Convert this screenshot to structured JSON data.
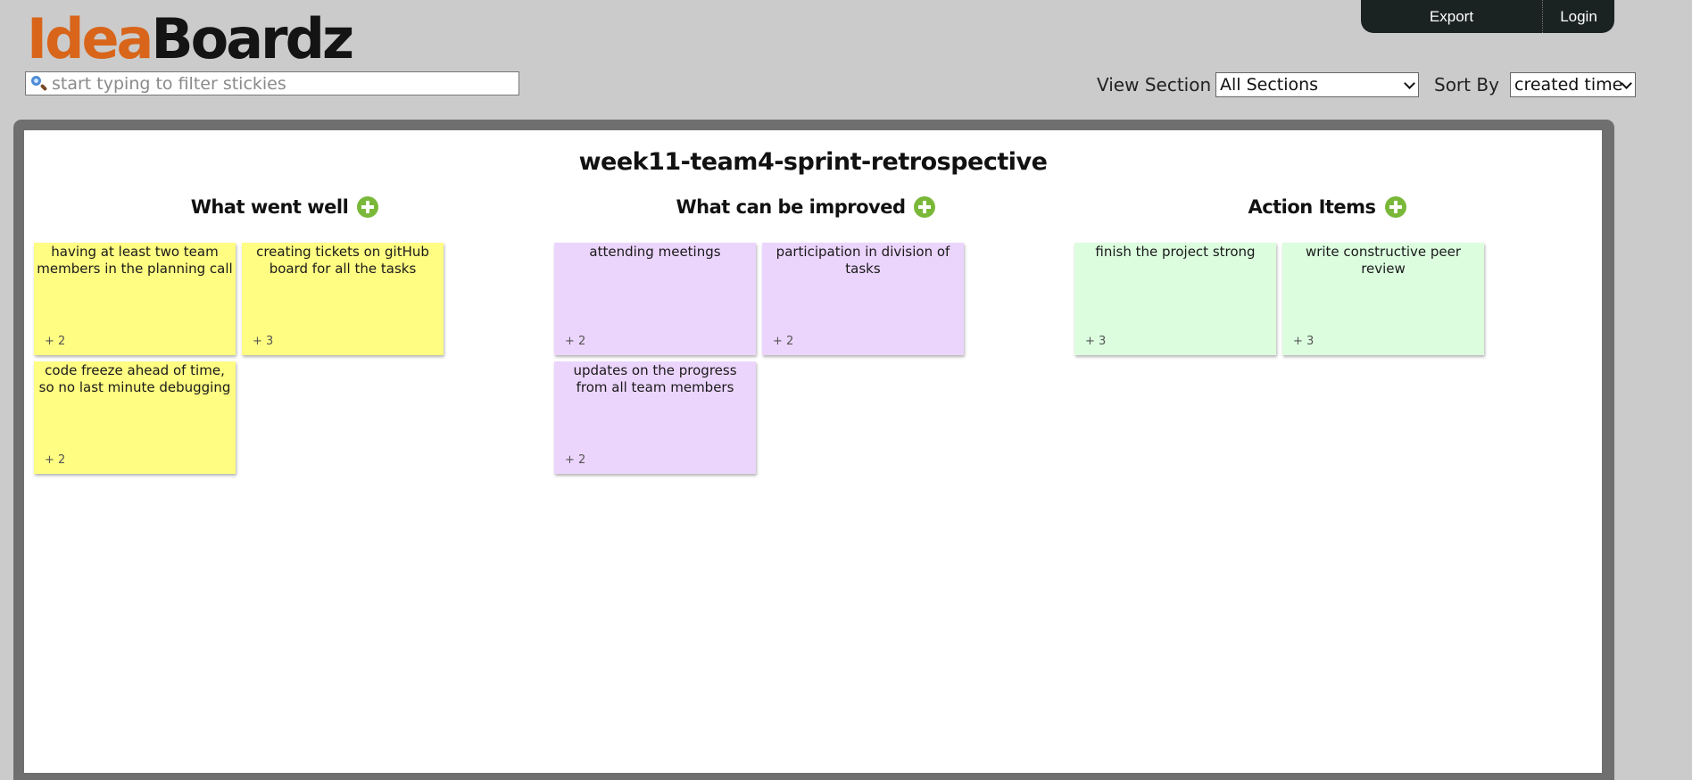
{
  "topbar": {
    "export_label": "Export",
    "login_label": "Login"
  },
  "logo": {
    "part1": "Idea",
    "part2": "Boardz"
  },
  "filter": {
    "placeholder": "start typing to filter stickies",
    "value": ""
  },
  "controls": {
    "view_section_label": "View Section",
    "view_section_value": "All Sections",
    "sort_by_label": "Sort By",
    "sort_by_value": "created time"
  },
  "board": {
    "title": "week11-team4-sprint-retrospective",
    "sections": [
      {
        "title": "What went well",
        "color": "#fffd82",
        "stickies": [
          {
            "text": "having at least two team members in the planning call",
            "votes": "+ 2"
          },
          {
            "text": "creating tickets on gitHub board for all the tasks",
            "votes": "+ 3"
          },
          {
            "text": "code freeze ahead of time, so no last minute debugging",
            "votes": "+ 2"
          }
        ]
      },
      {
        "title": "What can be improved",
        "color": "#ecd5fd",
        "stickies": [
          {
            "text": "attending meetings",
            "votes": "+ 2"
          },
          {
            "text": "participation in division of tasks",
            "votes": "+ 2"
          },
          {
            "text": "updates on the progress from all team members",
            "votes": "+ 2"
          }
        ]
      },
      {
        "title": "Action Items",
        "color": "#dcfedf",
        "stickies": [
          {
            "text": "finish the project strong",
            "votes": "+ 3"
          },
          {
            "text": "write constructive peer review",
            "votes": "+ 3"
          }
        ]
      }
    ]
  },
  "colors": {
    "page_background": "#cbcbcb",
    "topbar": "#1b2222",
    "logo_accent": "#d8651a",
    "add_button": "#7ab83a",
    "board_frame": "#6f6f6f"
  },
  "icons": {
    "search": "search-icon",
    "add": "plus-circle-icon",
    "dropdown": "chevron-down-icon"
  }
}
